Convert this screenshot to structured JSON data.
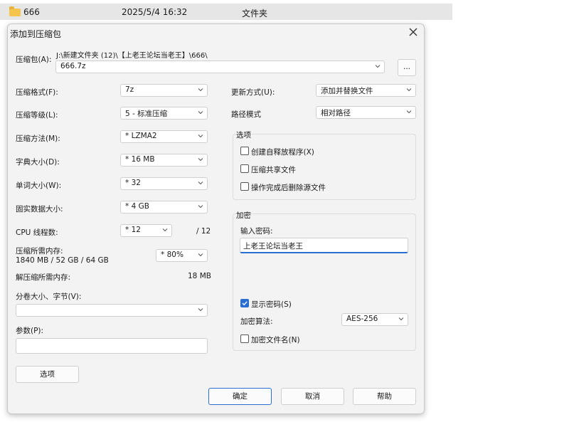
{
  "background_row": {
    "name": "666",
    "date": "2025/5/4 16:32",
    "type": "文件夹"
  },
  "dialog": {
    "title": "添加到压缩包",
    "archive_label": "压缩包(A):",
    "archive_path": "J:\\新建文件夹 (12)\\【上老王论坛当老王】\\666\\",
    "archive_name": "666.7z",
    "browse_label": "...",
    "format_label": "压缩格式(F):",
    "format_value": "7z",
    "level_label": "压缩等级(L):",
    "level_value": "5 - 标准压缩",
    "method_label": "压缩方法(M):",
    "method_value": "* LZMA2",
    "dict_label": "字典大小(D):",
    "dict_value": "* 16 MB",
    "word_label": "单词大小(W):",
    "word_value": "* 32",
    "solid_label": "固实数据大小:",
    "solid_value": "* 4 GB",
    "cpu_label": "CPU 线程数:",
    "cpu_value": "* 12",
    "cpu_total": "/ 12",
    "mem_label": "压缩所需内存:",
    "mem_detail": "1840 MB / 52 GB / 64 GB",
    "mem_value": "* 80%",
    "decomp_label": "解压缩所需内存:",
    "decomp_value": "18 MB",
    "split_label": "分卷大小、字节(V):",
    "split_value": "",
    "params_label": "参数(P):",
    "params_value": "",
    "options_button": "选项",
    "update_label": "更新方式(U):",
    "update_value": "添加并替换文件",
    "path_label": "路径模式",
    "path_value": "相对路径",
    "options_group": "选项",
    "opt_sfx": "创建自释放程序(X)",
    "opt_shared": "压缩共享文件",
    "opt_delete": "操作完成后删除源文件",
    "encrypt_group": "加密",
    "password_label": "输入密码:",
    "password_value": "上老王论坛当老王",
    "show_password": "显示密码(S)",
    "enc_method_label": "加密算法:",
    "enc_method_value": "AES-256",
    "enc_names": "加密文件名(N)",
    "ok": "确定",
    "cancel": "取消",
    "help": "帮助"
  },
  "colors": {
    "accent": "#2a6fcf",
    "dialog_bg": "#f3f3f3"
  }
}
